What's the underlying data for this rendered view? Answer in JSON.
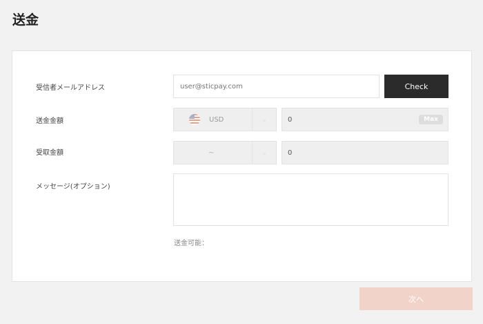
{
  "page": {
    "title": "送金"
  },
  "form": {
    "recipient_label": "受信者メールアドレス",
    "recipient_placeholder": "user@sticpay.com",
    "check_label": "Check",
    "send_label": "送金金額",
    "send_currency": "USD",
    "send_amount": "0",
    "max_label": "Max",
    "receive_label": "受取金額",
    "receive_currency": "~",
    "receive_amount": "0",
    "message_label": "メッセージ(オプション)",
    "available_label": "送金可能：",
    "next_label": "次へ"
  },
  "colors": {
    "accent": "#f2d3c9",
    "dark": "#2b2b2b"
  }
}
